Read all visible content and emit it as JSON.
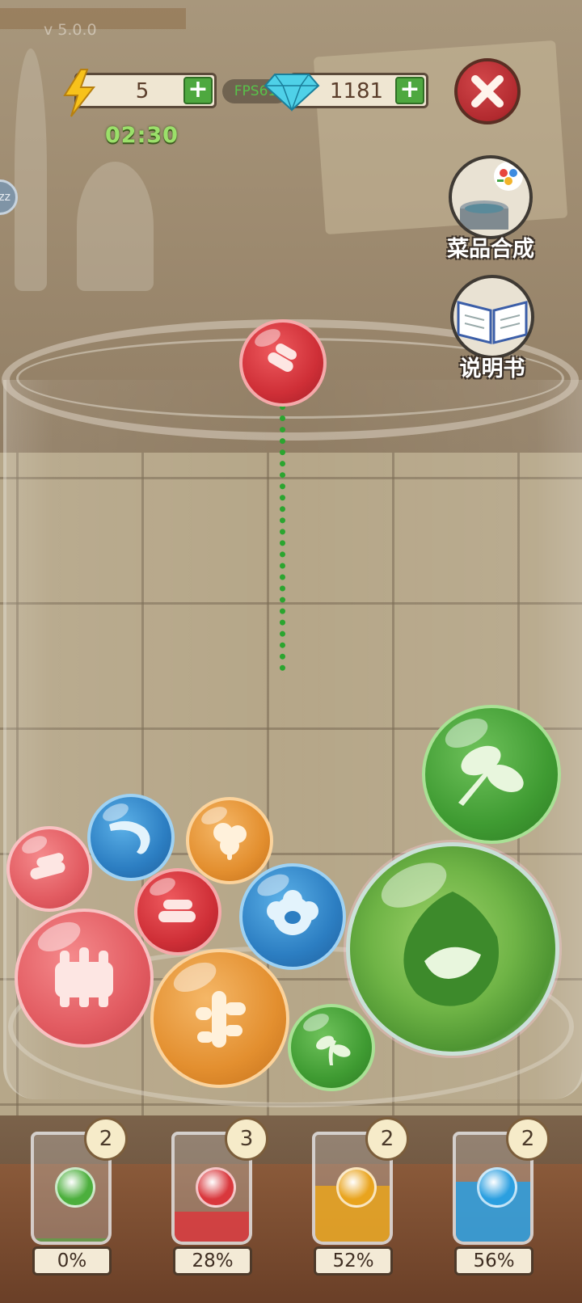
{
  "hud": {
    "version": "v 5.0.0",
    "energy": {
      "value": "5",
      "icon": "lightning-icon",
      "add_label": "+"
    },
    "timer": "02:30",
    "fps": "FPS61",
    "gems": {
      "value": "1181",
      "icon": "diamond-icon",
      "add_label": "+"
    },
    "close_icon": "close-icon",
    "sleep_indicator": "zz"
  },
  "side_menu": {
    "recipes": {
      "label": "菜品合成",
      "icon": "cooking-pot-icon"
    },
    "manual": {
      "label": "说明书",
      "icon": "book-icon"
    }
  },
  "play_area": {
    "current_ball": {
      "color": "red",
      "icon": "sausage-icon"
    },
    "balls": [
      {
        "color": "pink",
        "icon": "sausage-icon"
      },
      {
        "color": "blue",
        "icon": "shrimp-icon"
      },
      {
        "color": "orange",
        "icon": "mushroom-icon"
      },
      {
        "color": "red",
        "icon": "sausage-icon"
      },
      {
        "color": "blue",
        "icon": "scallop-icon"
      },
      {
        "color": "pink",
        "icon": "meat-ribs-icon"
      },
      {
        "color": "orange",
        "icon": "ginger-icon"
      },
      {
        "color": "green",
        "icon": "sprout-icon"
      },
      {
        "color": "green",
        "icon": "leaves-icon"
      },
      {
        "color": "green-rainbow",
        "icon": "vegetable-leaf-icon"
      }
    ]
  },
  "cups": [
    {
      "count": "2",
      "percent": "0%",
      "fill": 0.0,
      "color": "#4caf3d",
      "icon": "vegetable-icon"
    },
    {
      "count": "3",
      "percent": "28%",
      "fill": 0.28,
      "color": "#d9383d",
      "icon": "meat-icon"
    },
    {
      "count": "2",
      "percent": "52%",
      "fill": 0.52,
      "color": "#e9a41e",
      "icon": "spice-icon"
    },
    {
      "count": "2",
      "percent": "56%",
      "fill": 0.56,
      "color": "#2b9fe0",
      "icon": "seafood-icon"
    }
  ]
}
